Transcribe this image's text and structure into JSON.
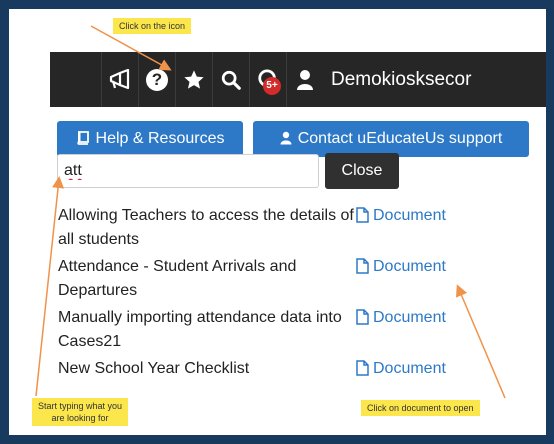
{
  "annotations": {
    "click_icon": "Click on the icon",
    "start_typing": "Start typing what you\nare looking for",
    "click_document": "Click on document to open"
  },
  "topbar": {
    "icons": [
      "megaphone-icon",
      "help-icon",
      "star-icon",
      "search-icon",
      "notification-icon",
      "user-icon"
    ],
    "notification_count": "5+",
    "user_name": "Demokiosksecor",
    "help_glyph": "?"
  },
  "buttons": {
    "help_resources": "Help & Resources",
    "contact_support": "Contact uEducateUs support",
    "close": "Close"
  },
  "search": {
    "value": "att"
  },
  "results": [
    {
      "title": "Allowing Teachers to access the details of all students",
      "link": "Document"
    },
    {
      "title": "Attendance - Student Arrivals and Departures",
      "link": "Document"
    },
    {
      "title": "Manually importing attendance data into Cases21",
      "link": "Document"
    },
    {
      "title": "New School Year Checklist",
      "link": "Document"
    }
  ],
  "colors": {
    "background": "#173a5e",
    "topbar": "#262626",
    "accent_blue": "#2d79c7",
    "note_yellow": "#fbe64c",
    "arrow_orange": "#f0934a"
  }
}
